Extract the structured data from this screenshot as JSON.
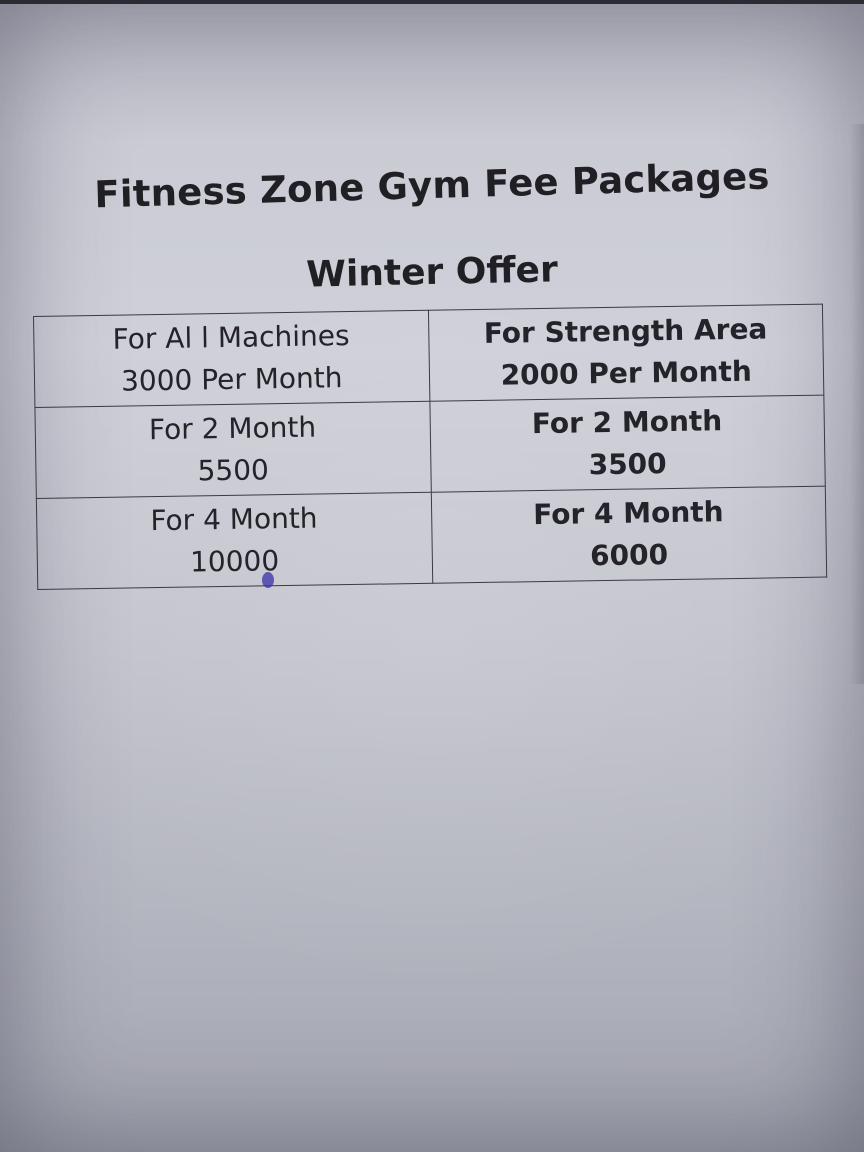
{
  "document": {
    "title": "Fitness Zone Gym Fee Packages",
    "subtitle": "Winter Offer"
  },
  "table": {
    "rows": [
      {
        "left": {
          "line1": "For Al l Machines",
          "line2": "3000 Per Month"
        },
        "right": {
          "line1": "For Strength Area",
          "line2": "2000 Per Month"
        }
      },
      {
        "left": {
          "line1": "For 2 Month",
          "line2": "5500"
        },
        "right": {
          "line1": "For 2 Month",
          "line2": "3500"
        }
      },
      {
        "left": {
          "line1": "For 4 Month",
          "line2": "10000"
        },
        "right": {
          "line1": "For 4 Month",
          "line2": "6000"
        }
      }
    ]
  },
  "colors": {
    "text": "#1f1f24",
    "table_border": "#3a3a44",
    "ink_mark": "#3b2fa8"
  }
}
